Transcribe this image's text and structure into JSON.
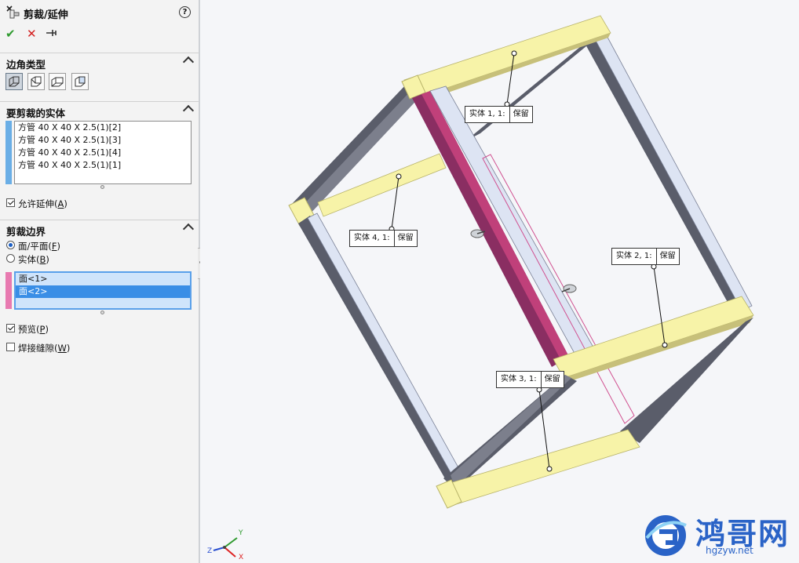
{
  "panel": {
    "title": "剪裁/延伸",
    "help": "?",
    "ok": "✔",
    "cancel": "✕",
    "pin": "⊣",
    "corner_section": {
      "title": "边角类型"
    },
    "bodies_section": {
      "title": "要剪裁的实体",
      "items": [
        "方管 40 X 40 X 2.5(1)[2]",
        "方管 40 X 40 X 2.5(1)[3]",
        "方管 40 X 40 X 2.5(1)[4]",
        "方管 40 X 40 X 2.5(1)[1]"
      ],
      "allow_extend": {
        "prefix": "允许延伸(",
        "key": "A",
        "suffix": ")",
        "checked": true
      }
    },
    "boundary_section": {
      "title": "剪裁边界",
      "opt_face": {
        "prefix": "面/平面(",
        "key": "F",
        "suffix": ")",
        "selected": true
      },
      "opt_body": {
        "prefix": "实体(",
        "key": "B",
        "suffix": ")",
        "selected": false
      },
      "faces": [
        "面<1>",
        "面<2>"
      ],
      "selected_face_index": 1
    },
    "preview": {
      "prefix": "预览(",
      "key": "P",
      "suffix": ")",
      "checked": true
    },
    "weld_gap": {
      "prefix": "焊接缝隙(",
      "key": "W",
      "suffix": ")",
      "checked": false
    }
  },
  "callouts": [
    {
      "id": "1",
      "label": "实体 1, 1:",
      "value": "保留"
    },
    {
      "id": "4",
      "label": "实体 4, 1:",
      "value": "保留"
    },
    {
      "id": "2",
      "label": "实体 2, 1:",
      "value": "保留"
    },
    {
      "id": "3",
      "label": "实体 3, 1:",
      "value": "保留"
    }
  ],
  "triad": {
    "x": "X",
    "y": "Y",
    "z": "Z"
  },
  "watermark": {
    "text": "鸿哥网",
    "url": "hgzyw.net"
  },
  "colors": {
    "tube_dark": "#5a5d6a",
    "tube_light": "#dde4f3",
    "tube_yellow": "#f7f3a8",
    "selected_magenta": "#c0407a",
    "bodies_bar": "#6aaee6",
    "boundary_bar": "#e87ab0",
    "selection_blue": "#3a8ee6"
  }
}
